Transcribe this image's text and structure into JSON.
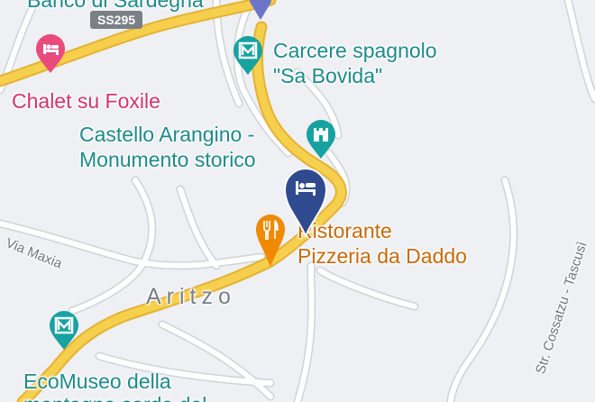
{
  "map": {
    "route_shield": "SS295",
    "town_label": "Aritzo",
    "places": {
      "top_cut": "Banco di Sardegna",
      "chalet": "Chalet su Foxile",
      "carcere_line1": "Carcere spagnolo",
      "carcere_line2": "\"Sa Bovida\"",
      "castello_line1": "Castello Arangino -",
      "castello_line2": "Monumento storico",
      "ristorante_line1": "Ristorante",
      "ristorante_line2": "Pizzeria da Daddo",
      "ecomuseo_line1": "EcoMuseo della",
      "ecomuseo_line2": "montagna sarda del"
    },
    "streets": {
      "via_maxia": "Via Maxia",
      "str_cossatzu": "Str. Cossatzu - Tascusì"
    },
    "icons": {
      "hotel_pin": "hotel-pin-icon",
      "museum": "museum-icon",
      "castle": "castle-icon",
      "restaurant": "restaurant-icon",
      "hotel": "hotel-icon"
    },
    "colors": {
      "background": "#eef0f3",
      "road_major": "#f6cf4d",
      "road_major_border": "#e5b234",
      "road_minor": "#ffffff",
      "road_minor_border": "#cfd3d8",
      "teal": "#1e8a8a",
      "pink": "#d6336c",
      "orange": "#e67a00",
      "pin": "#2f4a8f"
    }
  }
}
